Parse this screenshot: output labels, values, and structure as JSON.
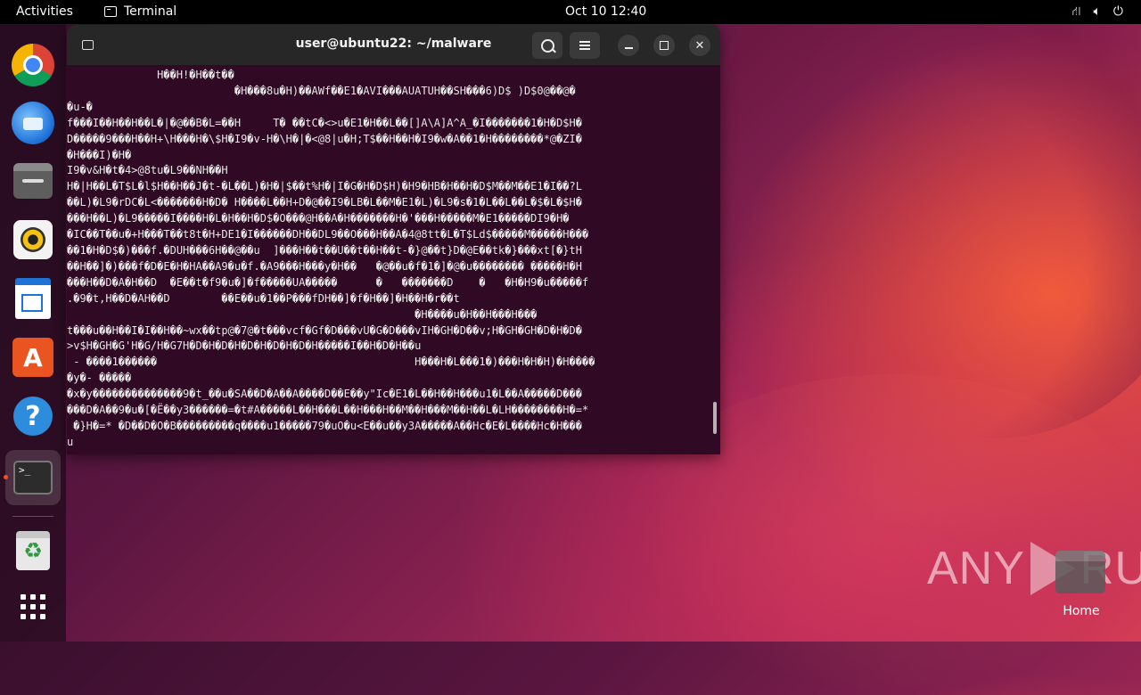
{
  "topbar": {
    "activities": "Activities",
    "app_name": "Terminal",
    "clock": "Oct 10  12:40",
    "tray_icons": [
      "network-icon",
      "volume-icon",
      "power-icon"
    ]
  },
  "dock": {
    "apps": [
      "Google Chrome",
      "Thunderbird Mail",
      "Files",
      "Rhythmbox",
      "LibreOffice Writer",
      "Ubuntu Software",
      "Help",
      "Terminal",
      "Trash",
      "Show Applications"
    ],
    "terminal_icon_text": ">_"
  },
  "desktop": {
    "home_label": "Home",
    "watermark_left": "ANY",
    "watermark_right": "RUN"
  },
  "terminal": {
    "title": "user@ubuntu22: ~/malware",
    "lines": [
      "              H��H!�H��t��",
      "                          �H���8u�H)��AWf��E1�AVI���AUATUH��SH���6)D$ )D$0@��@�",
      "�u-�",
      "f���I��H��H��L�|�@��B�L=��H     T� ��tC�<>u�E1�H��L��[]A\\A]A^A_�I�������1�H�D$H�",
      "D�����9���H��H+\\H���H�\\$H�I9�v-H�\\H�|�<@8|u�H;T$��H��H�I9�w�A��1�H��������*@�ZI�",
      "�H���I)�H�",
      "I9�v&H�t�4>@8tu�L9��NH��H",
      "H�|H��L�T$L�l$H��H��J�t-�L��L)�H�|$��t%H�|I�G�H�D$H)�H9�HB�H��H�D$M��M��E1�I��?L",
      "��L)�L9�rDC�L<�������H�D� H����L��H+D�@��I9�LB�L��M�E1�L)�L9�s�1�L��L��L�$�L�$H�",
      "���H��L)�L9�����I����H�L�H��H�D$�O���@H��A�H�������H�'���H�����M�E1�����DI9�H�",
      "�IC��T��u�+H���T��t8t�H+DE1�I������DH��DL9��O���H��A�4@8tt�L�T$Ld$�����M�����H���",
      "��1�H�D$�)���f.�DUH���6H��@��u  ]���H��t��U��t��H��t-�}@��t}D�@E��tk�}���xt[�}tH",
      "��H��]�)���f�D�E�H�HA��A9�u�f.�A9���H���y�H��   �@��u�f�1�]�@�u�������� �����H�H",
      "���H��D�A�H��D  �E��t�f9�u�]�f�����UA�����      �   �������D    �   �H�H9�u�����f",
      ".�9�t,H��D�AH��D        ��E��u�1��P���fDH��]�f�H��]�H��H�r��t",
      "                                                      �H����u�H��H���H���",
      "t���u��H��I�I��H��~wx��tp@�7@�t���vcf�Gf�D���vU�G�D���vIH�GH�D��v;H�GH�GH�D�H�D�",
      ">v$H�GH�G'H�G/H�G7H�D�H�D�H�D�H�D�H�D�H�����I��H�D�H��u",
      " - ����1������                                        H���H�L���1�)���H�H�H)�H����",
      "�y�- �����",
      "�x�y��������������9�t_��u�SA��D�A��A����D��E��y\"Ic�E1�L��H��H���u1�L��A�����D���",
      "���D�A��9�u�[�Ë��y3������=�t#A�����L��H���L��H���H��M��H���M��H��L�LH��������H�=*",
      " �}H�=* �D��D�O�B���������q����u1�����79�uO�u<E��u��y3A�����A��Hc�E�L����Hc�H���",
      "u"
    ]
  }
}
